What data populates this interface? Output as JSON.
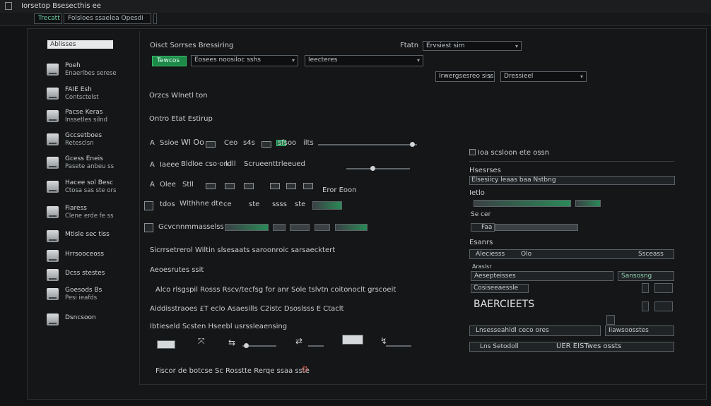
{
  "window": {
    "title": "Iorsetop Bsesecthis ee"
  },
  "tabs": [
    "Trecatt",
    "Folsloes ssaelea Opesdi"
  ],
  "sidebar": {
    "search_placeholder": "Ablisses",
    "items": [
      {
        "l1": "Poeh",
        "l2": "Enaerlbes serese"
      },
      {
        "l1": "FAIE Esh",
        "l2": "Contsctelst"
      },
      {
        "l1": "Pacse Keras",
        "l2": "Inssetles silnd"
      },
      {
        "l1": "Gccsetboes",
        "l2": "Retesclsn"
      },
      {
        "l1": "Gcess Eneis",
        "l2": "Pasete anbeu ss"
      },
      {
        "l1": "Hacee sol Besc",
        "l2": "Ctosa sas ste ors"
      },
      {
        "l1": "Fiaress",
        "l2": "Clene erde fe ss"
      },
      {
        "l1": "Mtisle sec tiss",
        "l2": ""
      },
      {
        "l1": "Hrrsooceoss",
        "l2": ""
      },
      {
        "l1": "Dcss stestes",
        "l2": ""
      },
      {
        "l1": "Goesods Bs",
        "l2": "Pesi ieafds"
      },
      {
        "l1": "Dsncsoon",
        "l2": ""
      }
    ]
  },
  "toolbar": {
    "label_left": "Oisct Sorrses Bressiring",
    "label_right": "Ftatn",
    "dropdown_right": "Ervsiest sim",
    "green_btn": "Tewcos",
    "field1": "Eosees noosiloc sshs",
    "field2": "Ieecteres",
    "field3": "Irwergsesreo sisss",
    "field4": "Dressieel"
  },
  "section1": "Orzcs Wlnetl ton",
  "section2": "Ontro Etat Estirup",
  "rows": {
    "r1": {
      "a": "A",
      "b": "Ssioe",
      "c": "Wl Oo",
      "d": "Ceo",
      "e": "s4s",
      "f": "coo",
      "g": "sfsoo",
      "h": "ilts"
    },
    "r2": {
      "a": "A",
      "b": "Iaeee",
      "c": "Bldloe cso·on",
      "d": "ldll",
      "e": "Scrueenttrleeued"
    },
    "r3": {
      "a": "A",
      "b": "Olee",
      "c": "Stll",
      "d": "Eror Eoon"
    },
    "r4": {
      "b": "tdos",
      "c": "Wlthhne dte",
      "d": "ce",
      "e": "ste",
      "f": "ssss",
      "g": "ste"
    },
    "r5": {
      "b": "Gcvcnnmmasselss"
    }
  },
  "line6": "Sicrrsetrerol Wiltin slsesaats saroonroic sarsaecktert",
  "line7": "Aeoesrutes ssit",
  "line8": "Alco rlsgspil Rosss   Rscv/tecfsg for anr Sole tslvtn coitonoclt grscoeit",
  "line9": "Aiddisstraoes   £T eclo   Asaesills   C2istc   Dsoslsss   E Ctaclt",
  "line10": "Ibtieseld Scsten Hseebl usrssleaensing",
  "footer": "Fiscor   de botcse Sc Rosstte   Rerqe   ssaa sste",
  "right": {
    "header": "Ioa scsloon ete ossn",
    "label1": "Hsesrses",
    "bar1": "Elsesiicy leaas baa Nstbng",
    "label2": "Ietlo",
    "label3": "Se cer",
    "label4": "Faa",
    "label5": "Esanrs",
    "row1a": "Aleciesss",
    "row1b": "Olo",
    "row1c": "Ssceass",
    "lbl_small": "Arasisr",
    "row2a": "Aesepteisses",
    "row2b": "Sansosng",
    "row3a": "Cosiseeaessle",
    "big_text": "BAERCIEETS",
    "btn1": "Lnsesseahldl ceco ores",
    "btn2": "Iiawsoosstes",
    "bottom": "Lns Setodoll",
    "bottom2": "UER EISTwes ossts"
  }
}
